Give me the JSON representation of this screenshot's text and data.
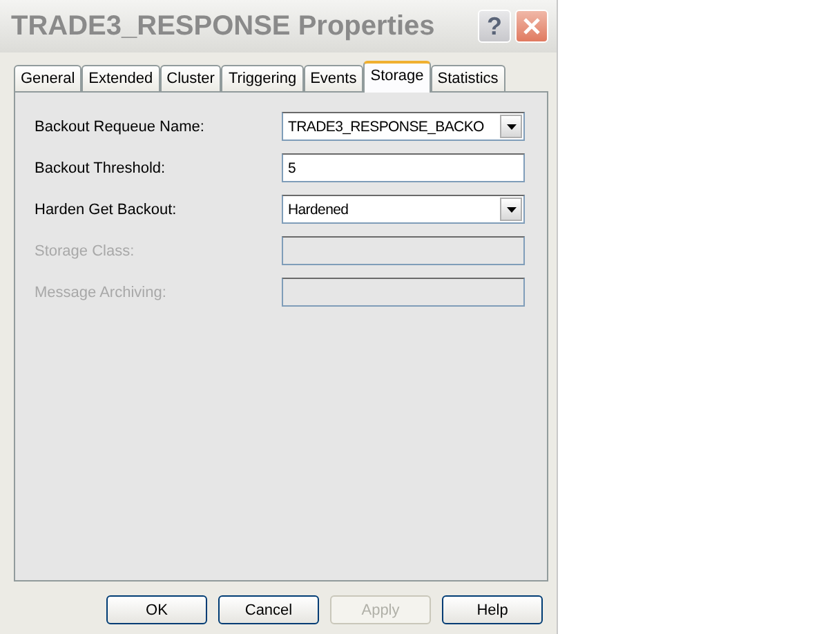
{
  "window": {
    "title": "TRADE3_RESPONSE Properties"
  },
  "title_buttons": [
    {
      "kind": "help",
      "label": "?"
    },
    {
      "kind": "close"
    }
  ],
  "tabs": [
    {
      "label": "General",
      "selected": false
    },
    {
      "label": "Extended",
      "selected": false
    },
    {
      "label": "Cluster",
      "selected": false
    },
    {
      "label": "Triggering",
      "selected": false
    },
    {
      "label": "Events",
      "selected": false
    },
    {
      "label": "Storage",
      "selected": true
    },
    {
      "label": "Statistics",
      "selected": false
    }
  ],
  "fields": [
    {
      "label": "Backout Requeue Name:",
      "kind": "dropdown",
      "value": "TRADE3_RESPONSE_BACKO",
      "disabled": false
    },
    {
      "label": "Backout Threshold:",
      "kind": "text",
      "value": "5",
      "disabled": false
    },
    {
      "label": "Harden Get Backout:",
      "kind": "dropdown",
      "value": "Hardened",
      "disabled": false
    },
    {
      "label": "Storage Class:",
      "kind": "text",
      "disabled": true
    },
    {
      "label": "Message Archiving:",
      "kind": "text",
      "disabled": true
    }
  ],
  "buttons": [
    {
      "label": "OK",
      "disabled": false
    },
    {
      "label": "Cancel",
      "disabled": false
    },
    {
      "label": "Apply",
      "disabled": true
    },
    {
      "label": "Help",
      "disabled": false
    }
  ]
}
